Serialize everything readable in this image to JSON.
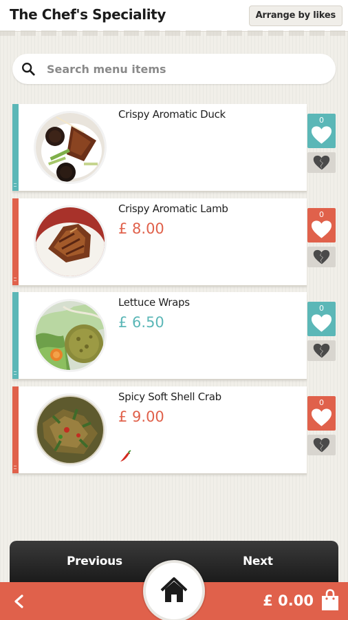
{
  "header": {
    "title": "The Chef's Speciality",
    "arrange_label": "Arrange by likes"
  },
  "search": {
    "placeholder": "Search menu items",
    "value": ""
  },
  "menu": {
    "items": [
      {
        "name": "Crispy Aromatic Duck",
        "price": "",
        "likes": "0",
        "accent": "#5bb7b7",
        "photo": "duck-plate",
        "spicy": false
      },
      {
        "name": "Crispy Aromatic Lamb",
        "price": "£ 8.00",
        "likes": "0",
        "accent": "#e0614b",
        "photo": "lamb-plate",
        "spicy": false
      },
      {
        "name": "Lettuce Wraps",
        "price": "£ 6.50",
        "likes": "0",
        "accent": "#5bb7b7",
        "photo": "lettuce-wraps-plate",
        "spicy": false
      },
      {
        "name": "Spicy Soft Shell Crab",
        "price": "£ 9.00",
        "likes": "0",
        "accent": "#e0614b",
        "photo": "crab-plate",
        "spicy": true
      }
    ]
  },
  "nav": {
    "previous_label": "Previous",
    "next_label": "Next"
  },
  "footer": {
    "total": "£ 0.00"
  },
  "colors": {
    "teal": "#5bb7b7",
    "coral": "#e0614b",
    "footer_bar": "#e0614b",
    "nav_bar": "#2a2a2a"
  },
  "icons": [
    "search-icon",
    "heart-icon",
    "broken-heart-icon",
    "chili-icon",
    "back-arrow-icon",
    "home-icon",
    "shopping-bag-icon"
  ]
}
